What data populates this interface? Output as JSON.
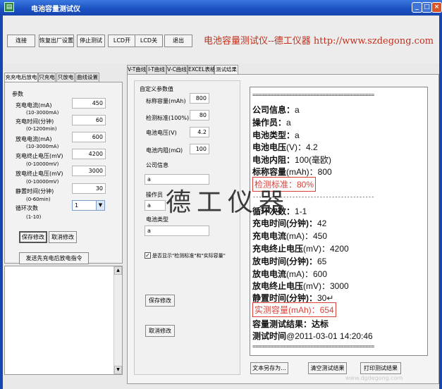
{
  "window": {
    "title": "电池容量测试仪",
    "icon": "battery-app-icon",
    "min": "_",
    "max": "□",
    "close": "×"
  },
  "toolbar": {
    "buttons": [
      "连接",
      "恢复出厂设置",
      "停止测试",
      "LCD开",
      "LCD关",
      "退出"
    ],
    "brand": "电池容量测试仪--德工仪器 http://www.szdegong.com"
  },
  "left_tabs": [
    "充充电后放电",
    "只充电",
    "只放电",
    "曲线设置"
  ],
  "params": {
    "group_title": "参数",
    "rows": [
      {
        "label": "充电电流(mA)",
        "range": "(10-3000mA)",
        "value": "450"
      },
      {
        "label": "充电时间(分钟)",
        "range": "(0-1200min)",
        "value": "60"
      },
      {
        "label": "放电电流(mA)",
        "range": "(10-3000mA)",
        "value": "600"
      },
      {
        "label": "充电终止电压(mV)",
        "range": "(0-10000mV)",
        "value": "4200"
      },
      {
        "label": "放电终止电压(mV)",
        "range": "(0-10000mV)",
        "value": "3000"
      },
      {
        "label": "静置时间(分钟)",
        "range": "(0-60min)",
        "value": "30"
      }
    ],
    "cycle": {
      "label": "循环次数",
      "range": "(1-10)",
      "value": "1",
      "arrow": "▼"
    },
    "save": "保存修改",
    "cancel": "取消修改",
    "send": "发送先充电后放电指令"
  },
  "log": {
    "up": "▲",
    "down": "▼"
  },
  "main_tabs": [
    "V-T曲线",
    "I-T曲线",
    "V-C曲线",
    "EXCEL表格",
    "测试结果"
  ],
  "custom": {
    "title": "自定义参数值",
    "nominal": {
      "label": "标称容量(mAh)",
      "value": "800"
    },
    "standard": {
      "label": "检测标准(100%)",
      "value": "80"
    },
    "voltage": {
      "label": "电池电压(V)",
      "value": "4.2"
    },
    "resistance": {
      "label": "电池内阻(mΩ)",
      "value": "100"
    },
    "company": {
      "label": "公司信息",
      "value": "a"
    },
    "operator": {
      "label": "操作员",
      "value": "a"
    },
    "type": {
      "label": "电池类型",
      "value": "a"
    },
    "check": {
      "mark": "✓",
      "label": "是否显示\"检测标准\"和\"实际容量\""
    },
    "save": "保存修改",
    "cancel": "取消修改"
  },
  "result": {
    "sep": "========================================",
    "sep2": "----------------------------------------",
    "company": {
      "k": "公司信息：",
      "v": "a"
    },
    "operator": {
      "k": "操作员：",
      "v": "a"
    },
    "type": {
      "k": "电池类型：",
      "v": "a"
    },
    "voltage": {
      "k": "电池电压",
      "v": "(V)：4.2"
    },
    "resistance": {
      "k": "电池内阻：",
      "v": "100(毫欧)"
    },
    "nominal": {
      "k": "标称容量",
      "v": "(mAh)：800"
    },
    "standard": "检测标准：80%",
    "cycle": {
      "k": "循环次数：",
      "v": "1-1"
    },
    "charge_time": {
      "k": "充电时间(分钟)：",
      "v": "42"
    },
    "charge_current": {
      "k": "充电电流",
      "v": "(mA)：450"
    },
    "charge_end": {
      "k": "充电终止电压",
      "v": "(mV)：4200"
    },
    "discharge_time": {
      "k": "放电时间(分钟)：",
      "v": "65"
    },
    "discharge_current": {
      "k": "放电电流",
      "v": "(mA)：600"
    },
    "discharge_end": {
      "k": "放电终止电压",
      "v": "(mV)：3000"
    },
    "rest_time": {
      "k": "静置时间(分钟)：",
      "v": "30↵"
    },
    "actual": "实测容量(mAh)：654",
    "result_line": "容量测试结果：达标",
    "time": {
      "k": "测试时间",
      "v": "@2011-03-01 14:20:46"
    }
  },
  "bottom": {
    "save_text": "文本另存为...",
    "clear": "清空测试结果",
    "print": "打印测试结果"
  },
  "watermark": "德工仪器",
  "footer": "www.dgdegong.com"
}
